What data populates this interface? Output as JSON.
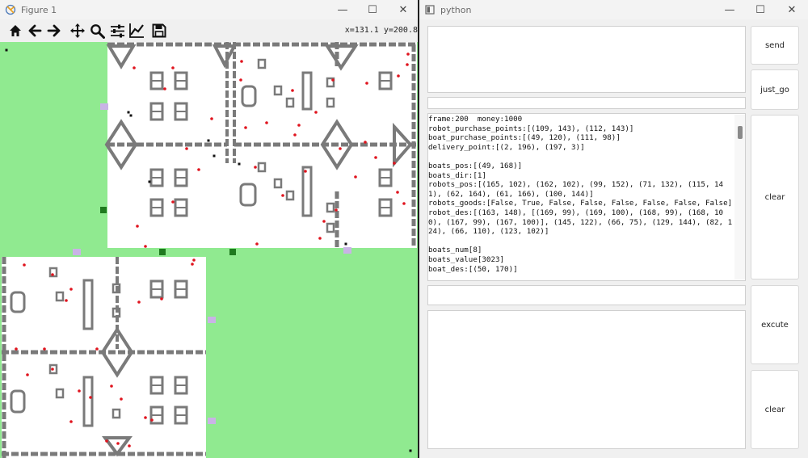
{
  "figure_window": {
    "title": "Figure 1",
    "controls": {
      "minimize": "—",
      "maximize": "☐",
      "close": "✕"
    },
    "toolbar_icons": [
      "home-icon",
      "back-icon",
      "forward-icon",
      "pan-icon",
      "zoom-icon",
      "configure-subplots-icon",
      "edit-axis-icon",
      "save-icon"
    ],
    "coords": "x=131.1  y=200.8"
  },
  "python_window": {
    "title": "python",
    "controls": {
      "minimize": "—",
      "maximize": "☐",
      "close": "✕"
    },
    "buttons": {
      "send": "send",
      "just_go": "just_go",
      "clear_top": "clear",
      "excute": "excute",
      "clear_bottom": "clear"
    },
    "log": [
      "frame:200  money:1000",
      "robot_purchase_points:[(109, 143), (112, 143)]",
      "boat_purchase_points:[(49, 120), (111, 98)]",
      "delivery_point:[(2, 196), (197, 3)]",
      "",
      "boats_pos:[(49, 168)]",
      "boats_dir:[1]",
      "robots_pos:[(165, 102), (162, 102), (99, 152), (71, 132), (115, 141), (62, 164), (61, 166), (100, 144)]",
      "robots_goods:[False, True, False, False, False, False, False, False]",
      "robot_des:[(163, 148), [(169, 99), (169, 100), (168, 99), (168, 100), (167, 99), (167, 100)], (145, 122), (66, 75), (129, 144), (82, 124), (66, 110), (123, 102)]",
      "",
      "boats_num[8]",
      "boats_value[3023]",
      "boat_des:[(50, 170)]"
    ]
  },
  "colors": {
    "land": "#90ea90",
    "port_area": "#ffffff",
    "road": "#7a7a7a",
    "goods": "#e0141e",
    "robot": "#111111",
    "purchase_point": "#1f7a1f",
    "delivery_point": "#c9b3e6"
  }
}
